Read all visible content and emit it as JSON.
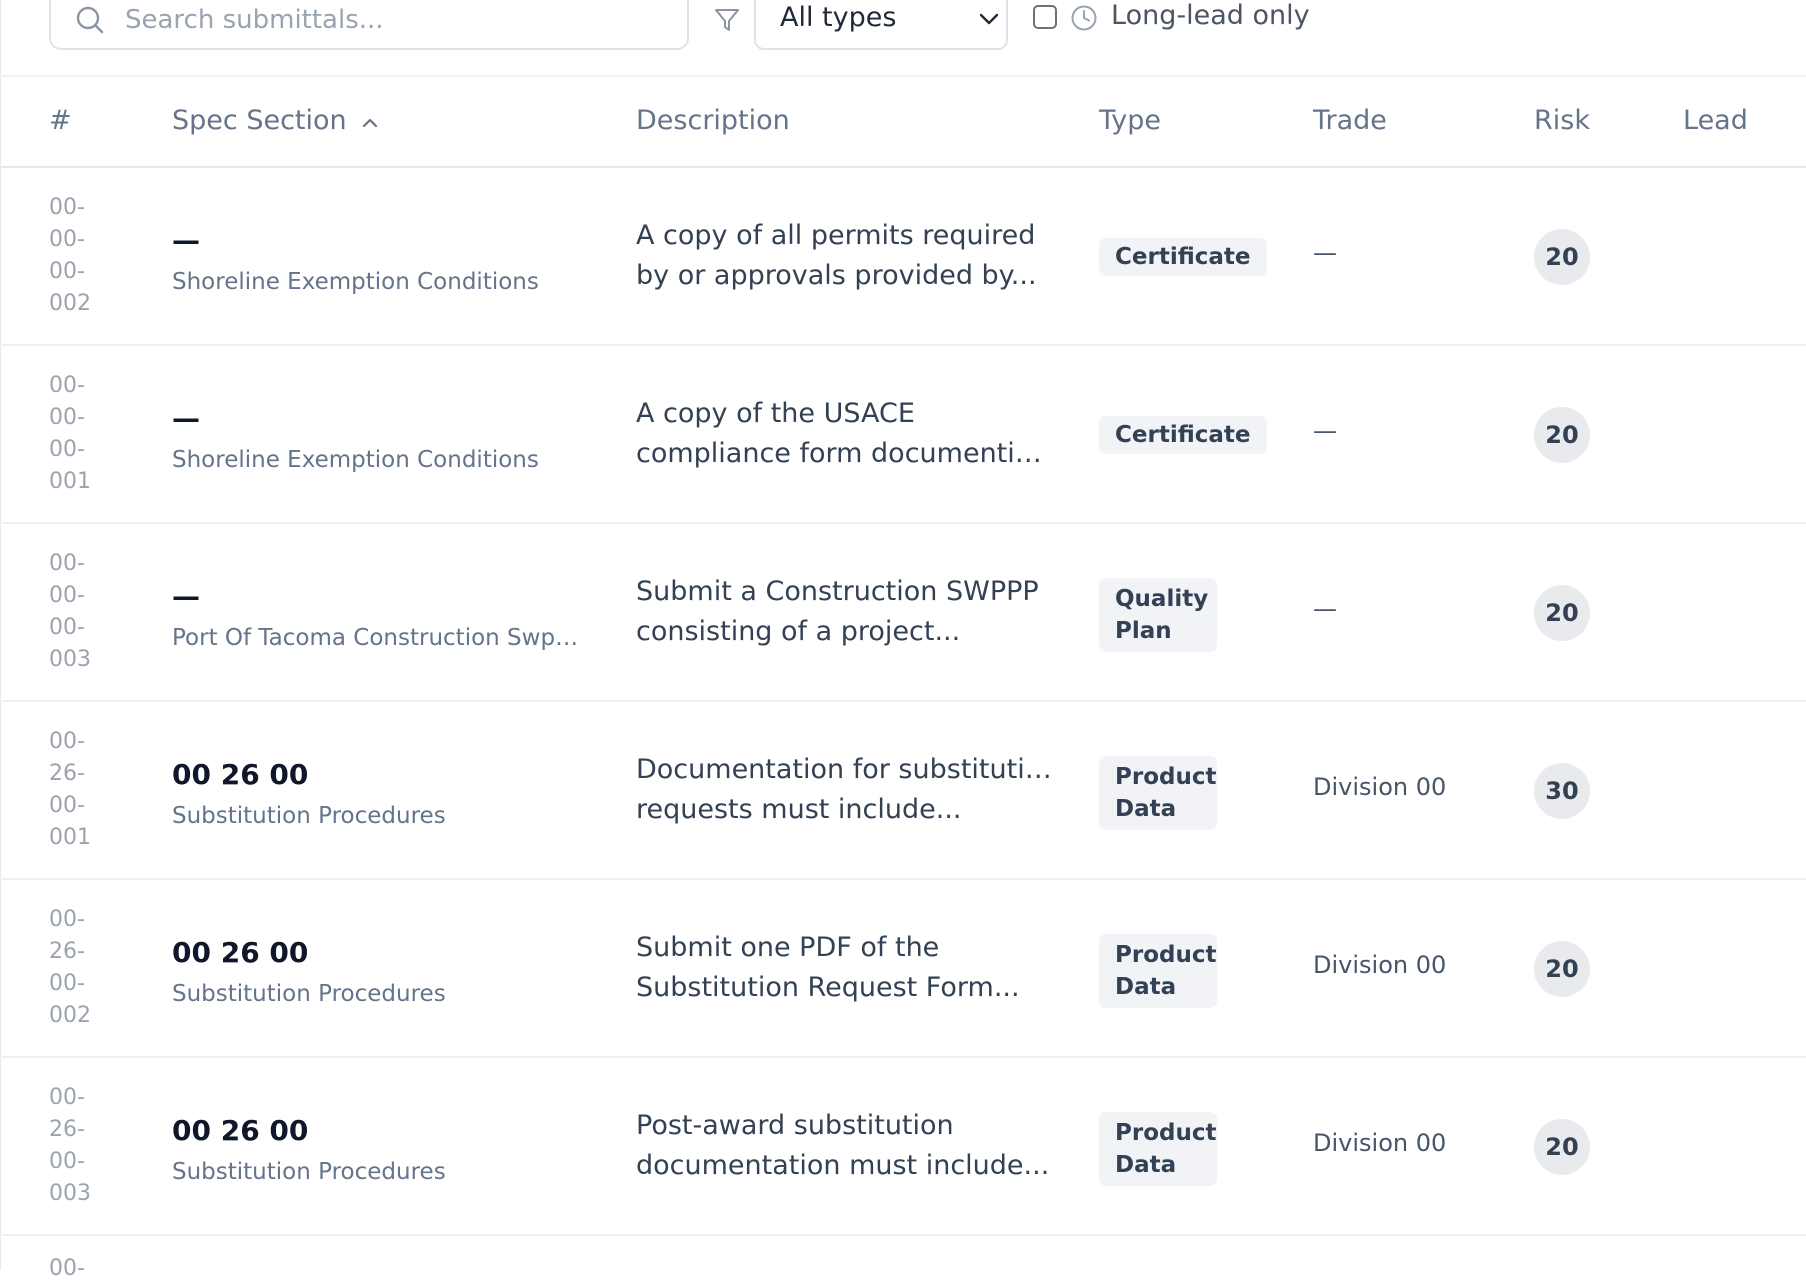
{
  "toolbar": {
    "search_placeholder": "Search submittals...",
    "type_filter_value": "All types",
    "long_lead_label": "Long-lead only",
    "long_lead_checked": false
  },
  "table": {
    "headers": {
      "num": "#",
      "spec_section": "Spec Section",
      "description": "Description",
      "type": "Type",
      "trade": "Trade",
      "risk": "Risk",
      "lead": "Lead"
    },
    "rows": [
      {
        "num_parts": [
          "00-",
          "00-",
          "00-",
          "002"
        ],
        "spec_code": "—",
        "spec_name": "Shoreline Exemption Conditions",
        "desc_lines": [
          "A copy of all permits required",
          "by or approvals provided by..."
        ],
        "type_lines": [
          "Certificate"
        ],
        "trade": "—",
        "risk": "20"
      },
      {
        "num_parts": [
          "00-",
          "00-",
          "00-",
          "001"
        ],
        "spec_code": "—",
        "spec_name": "Shoreline Exemption Conditions",
        "desc_lines": [
          "A copy of the USACE",
          "compliance form documentin..."
        ],
        "type_lines": [
          "Certificate"
        ],
        "trade": "—",
        "risk": "20"
      },
      {
        "num_parts": [
          "00-",
          "00-",
          "00-",
          "003"
        ],
        "spec_code": "—",
        "spec_name": "Port Of Tacoma Construction Swpp...",
        "desc_lines": [
          "Submit a Construction SWPPP",
          "consisting of a project..."
        ],
        "type_lines": [
          "Quality",
          "Plan"
        ],
        "trade": "—",
        "risk": "20"
      },
      {
        "num_parts": [
          "00-",
          "26-",
          "00-",
          "001"
        ],
        "spec_code": "00 26 00",
        "spec_name": "Substitution Procedures",
        "desc_lines": [
          "Documentation for substitution",
          "requests must include..."
        ],
        "type_lines": [
          "Product",
          "Data"
        ],
        "trade": "Division 00",
        "risk": "30"
      },
      {
        "num_parts": [
          "00-",
          "26-",
          "00-",
          "002"
        ],
        "spec_code": "00 26 00",
        "spec_name": "Substitution Procedures",
        "desc_lines": [
          "Submit one PDF of the",
          "Substitution Request Form..."
        ],
        "type_lines": [
          "Product",
          "Data"
        ],
        "trade": "Division 00",
        "risk": "20"
      },
      {
        "num_parts": [
          "00-",
          "26-",
          "00-",
          "003"
        ],
        "spec_code": "00 26 00",
        "spec_name": "Substitution Procedures",
        "desc_lines": [
          "Post-award substitution",
          "documentation must include..."
        ],
        "type_lines": [
          "Product",
          "Data"
        ],
        "trade": "Division 00",
        "risk": "20"
      }
    ],
    "partial_next_num": "00-"
  },
  "icons": {
    "search": "search-icon",
    "filter": "filter-icon",
    "chevron": "chevron-down-icon",
    "clock": "clock-icon",
    "sort": "sort-ascending-icon"
  },
  "colors": {
    "header_text": "#64748b",
    "badge_bg": "#f1f3f6",
    "risk_bg": "#e8eaed",
    "muted_text": "#9ca3af"
  }
}
